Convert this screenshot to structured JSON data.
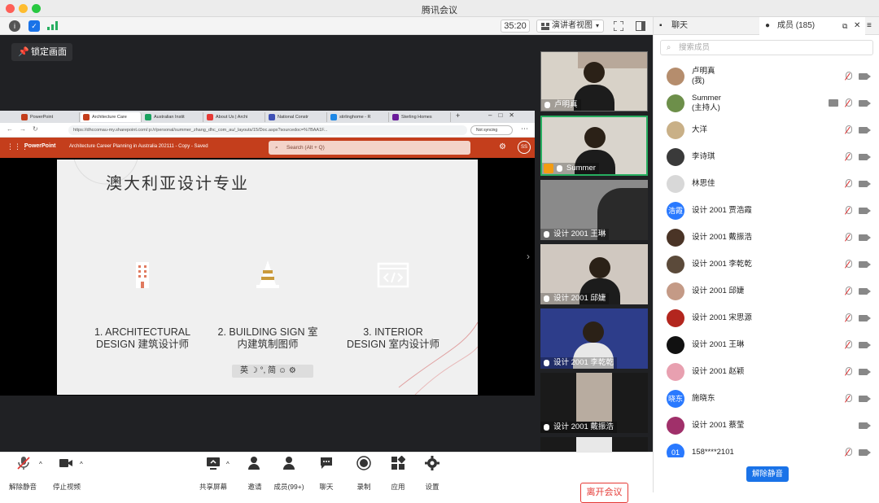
{
  "window": {
    "title": "腾讯会议"
  },
  "toolbar": {
    "timer": "35:20",
    "view_label": "演讲者视图"
  },
  "stage": {
    "lock_label": "锁定画面"
  },
  "browser": {
    "tabs": [
      "PowerPoint",
      "Architecture Care",
      "Australian Instit",
      "About Us | Archi",
      "National Constr",
      "stirlinghome - R",
      "Sterling Homes"
    ],
    "url": "https://dhccomau-my.sharepoint.com/:p:/r/personal/summer_zhang_dhc_com_au/_layouts/15/Doc.aspx?sourcedoc=%7BAA1F...",
    "sync_label": "Not syncing",
    "app_name": "PowerPoint",
    "doc_title": "Architecture Career Planning in Australia 202111 - Copy - Saved",
    "search_placeholder": "Search (Alt + Q)",
    "avatar_initials": "SS"
  },
  "slide": {
    "title": "澳大利亚设计专业",
    "cards": [
      {
        "label_line1": "1. ARCHITECTURAL",
        "label_line2": "DESIGN 建筑设计师",
        "color": "#e07a5f",
        "icon": "building-icon"
      },
      {
        "label_line1": "2. BUILDING SIGN 室",
        "label_line2": "内建筑制图师",
        "color": "#c99a3b",
        "icon": "traffic-cone-icon"
      },
      {
        "label_line1": "3. INTERIOR",
        "label_line2": "DESIGN 室内设计师",
        "color": "#8a9a3a",
        "icon": "code-window-icon"
      }
    ],
    "ime_bar": "英 ☽ °, 简 ☺ ⚙"
  },
  "videos": [
    {
      "name": "卢明真"
    },
    {
      "name": "Summer"
    },
    {
      "name": "设计 2001 王琳"
    },
    {
      "name": "设计 2001 邱婕"
    },
    {
      "name": "设计 2001 李乾乾"
    },
    {
      "name": "设计 2001 戴振浩"
    }
  ],
  "controls": {
    "unmute": "解除静音",
    "stop_video": "停止视频",
    "share": "共享屏幕",
    "invite": "邀请",
    "members": "成员(99+)",
    "chat": "聊天",
    "record": "录制",
    "apps": "应用",
    "settings": "设置",
    "leave": "离开会议"
  },
  "right_panel": {
    "chat_tab": "聊天",
    "members_tab": "成员 (185)",
    "search_placeholder": "搜索成员",
    "unmute_all": "解除静音",
    "members": [
      {
        "name": "卢明真",
        "sub": "(我)",
        "avatar_color": "#b58d6d",
        "initials": ""
      },
      {
        "name": "Summer",
        "sub": "(主持人)",
        "avatar_color": "#6d8f4a",
        "initials": ""
      },
      {
        "name": "大洋",
        "sub": "",
        "avatar_color": "#c9b087",
        "initials": ""
      },
      {
        "name": "李诗琪",
        "sub": "",
        "avatar_color": "#3a3a3a",
        "initials": ""
      },
      {
        "name": "林思佳",
        "sub": "",
        "avatar_color": "#d8d8d8",
        "initials": ""
      },
      {
        "name": "设计 2001 贾浩霞",
        "sub": "",
        "avatar_color": "#2979ff",
        "initials": "浩霞"
      },
      {
        "name": "设计 2001 戴振浩",
        "sub": "",
        "avatar_color": "#4a3426",
        "initials": ""
      },
      {
        "name": "设计 2001 李乾乾",
        "sub": "",
        "avatar_color": "#5b4a3a",
        "initials": ""
      },
      {
        "name": "设计 2001 邱婕",
        "sub": "",
        "avatar_color": "#c49a86",
        "initials": ""
      },
      {
        "name": "设计 2001 宋思源",
        "sub": "",
        "avatar_color": "#b3261e",
        "initials": ""
      },
      {
        "name": "设计 2001 王琳",
        "sub": "",
        "avatar_color": "#111111",
        "initials": ""
      },
      {
        "name": "设计 2001 赵颖",
        "sub": "",
        "avatar_color": "#e8a0b0",
        "initials": ""
      },
      {
        "name": "施晓东",
        "sub": "",
        "avatar_color": "#2979ff",
        "initials": "晓东"
      },
      {
        "name": "设计 2001 蔡莹",
        "sub": "",
        "avatar_color": "#a0306a",
        "initials": ""
      },
      {
        "name": "158****2101",
        "sub": "",
        "avatar_color": "#2979ff",
        "initials": "01"
      }
    ]
  }
}
